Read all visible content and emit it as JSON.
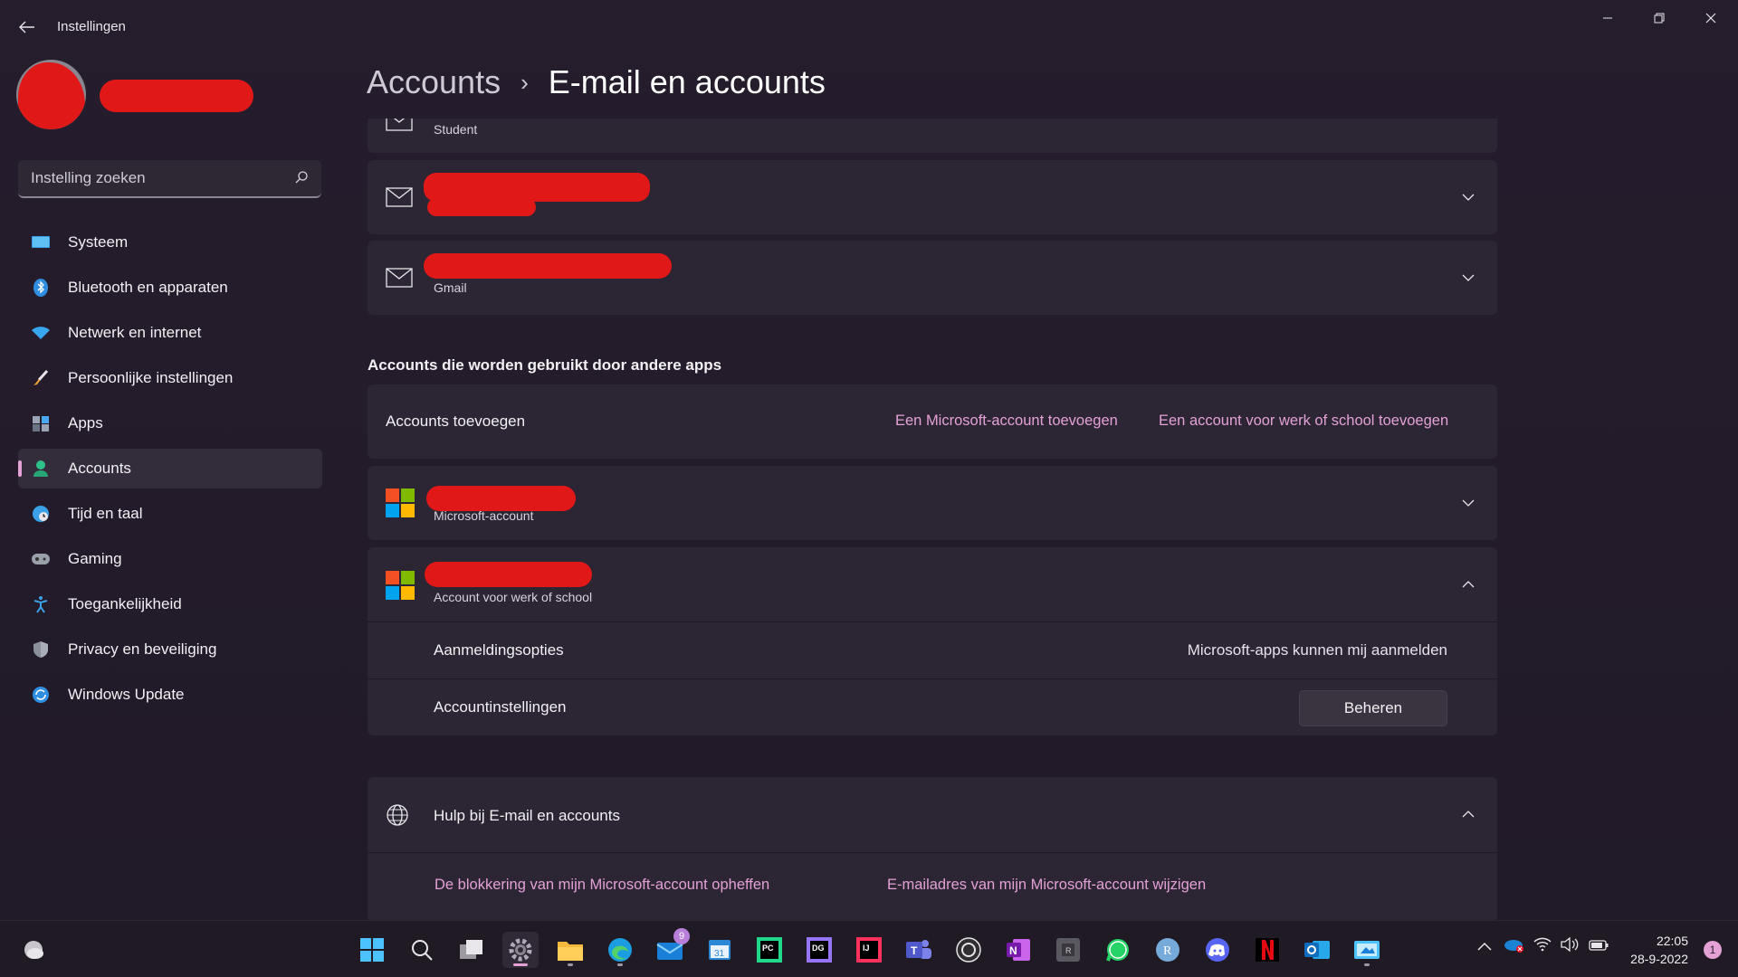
{
  "window": {
    "app_title": "Instellingen"
  },
  "search": {
    "placeholder": "Instelling zoeken"
  },
  "sidebar": {
    "items": [
      {
        "label": "Systeem",
        "icon": "monitor-icon"
      },
      {
        "label": "Bluetooth en apparaten",
        "icon": "bluetooth-icon"
      },
      {
        "label": "Netwerk en internet",
        "icon": "wifi-icon"
      },
      {
        "label": "Persoonlijke instellingen",
        "icon": "brush-icon"
      },
      {
        "label": "Apps",
        "icon": "apps-icon"
      },
      {
        "label": "Accounts",
        "icon": "person-icon"
      },
      {
        "label": "Tijd en taal",
        "icon": "globe-clock-icon"
      },
      {
        "label": "Gaming",
        "icon": "gamepad-icon"
      },
      {
        "label": "Toegankelijkheid",
        "icon": "accessibility-icon"
      },
      {
        "label": "Privacy en beveiliging",
        "icon": "shield-icon"
      },
      {
        "label": "Windows Update",
        "icon": "update-icon"
      }
    ],
    "active_index": 5
  },
  "header": {
    "parent": "Accounts",
    "separator": "›",
    "current": "E-mail en accounts"
  },
  "email_accounts": [
    {
      "subtitle": "Student"
    },
    {
      "subtitle": ""
    },
    {
      "subtitle": "Gmail"
    }
  ],
  "other_apps": {
    "section_title": "Accounts die worden gebruikt door andere apps",
    "add_label": "Accounts toevoegen",
    "add_ms_link": "Een Microsoft-account toevoegen",
    "add_work_link": "Een account voor werk of school toevoegen",
    "ms_account_sub": "Microsoft-account",
    "work_account_sub": "Account voor werk of school",
    "signin_label": "Aanmeldingsopties",
    "signin_value": "Microsoft-apps kunnen mij aanmelden",
    "settings_label": "Accountinstellingen",
    "manage_button": "Beheren"
  },
  "help": {
    "title": "Hulp bij E-mail en accounts",
    "link1": "De blokkering van mijn Microsoft-account opheffen",
    "link2": "E-mailadres van mijn Microsoft-account wijzigen"
  },
  "taskbar": {
    "mail_badge": "9",
    "time": "22:05",
    "date": "28-9-2022",
    "notification_count": "1"
  },
  "colors": {
    "accent": "#e4a1d6",
    "background": "#221b2a",
    "card": "#2c2533",
    "redaction": "#e01818"
  }
}
